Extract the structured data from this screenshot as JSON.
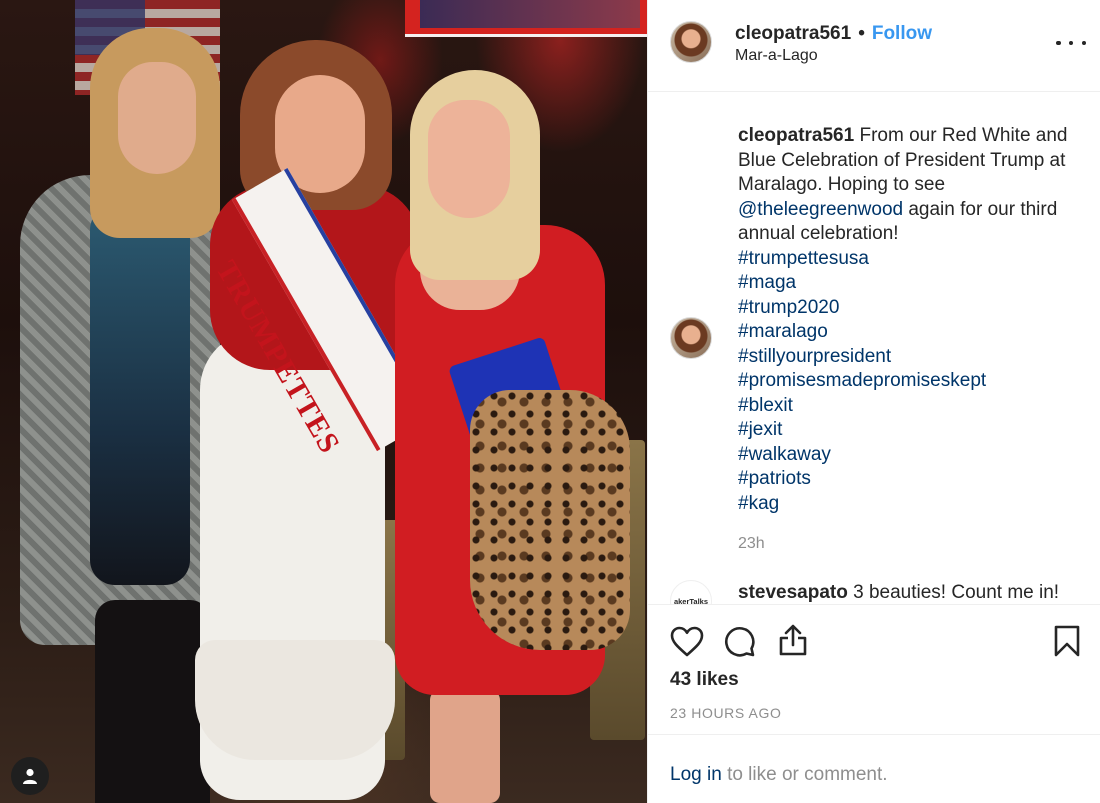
{
  "header": {
    "username": "cleopatra561",
    "separator": "•",
    "follow_label": "Follow",
    "location": "Mar-a-Lago",
    "more_icon": "more-options-icon"
  },
  "photo": {
    "sash_text": "TRUMPETTES",
    "user_badge_icon": "user-icon"
  },
  "caption": {
    "username": "cleopatra561",
    "text_before_mention": "From our Red White and Blue Celebration of President Trump at Maralago. Hoping to see",
    "mention": "@theleegreenwood",
    "text_after_mention": "again for our third annual celebration!",
    "hashtags": [
      "#trumpettesusa",
      "#maga",
      "#trump2020",
      "#maralago",
      "#stillyourpresident",
      "#promisesmadepromiseskept",
      "#blexit",
      "#jexit",
      "#walkaway",
      "#patriots",
      "#kag"
    ],
    "time": "23h"
  },
  "comment2": {
    "avatar_text": "akerTalks",
    "username": "stevesapato",
    "text": "3 beauties! Count me in!"
  },
  "actions": {
    "icons": [
      "heart-icon",
      "comment-icon",
      "share-icon",
      "bookmark-icon"
    ],
    "likes": "43 likes",
    "timestamp": "23 HOURS AGO"
  },
  "login": {
    "link": "Log in",
    "text": "to like or comment."
  },
  "colors": {
    "link_blue": "#3897f0",
    "hashtag_navy": "#003569",
    "muted_gray": "#8e8e8e",
    "text": "#262626"
  }
}
